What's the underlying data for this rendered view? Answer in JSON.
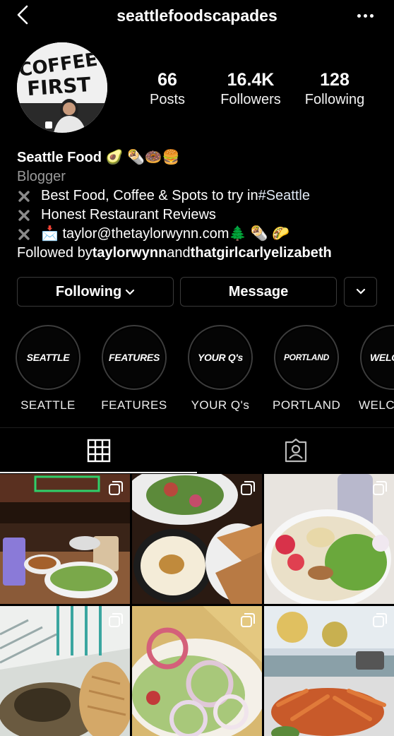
{
  "header": {
    "username": "seattlefoodscapades"
  },
  "avatar": {
    "sign_line1": "COFFEE",
    "sign_line2": "FIRST"
  },
  "stats": [
    {
      "value": "66",
      "label": "Posts"
    },
    {
      "value": "16.4K",
      "label": "Followers"
    },
    {
      "value": "128",
      "label": "Following"
    }
  ],
  "bio": {
    "name": "Seattle Food 🥑 🌯🍩🍔",
    "category": "Blogger",
    "line1_text": "Best Food, Coffee & Spots to try in ",
    "line1_hashtag": "#Seattle",
    "line2_text": "Honest Restaurant Reviews",
    "line3_text": "📩 taylor@thetaylorwynn.com🌲 🌯 🌮",
    "followed_prefix": "Followed by ",
    "followed_user1": "taylorwynn",
    "followed_and": " and ",
    "followed_user2": "thatgirlcarlyelizabeth"
  },
  "buttons": {
    "following": "Following",
    "message": "Message"
  },
  "highlights": [
    {
      "cover": "SEATTLE",
      "label": "SEATTLE"
    },
    {
      "cover": "FEATURES",
      "label": "FEATURES"
    },
    {
      "cover": "YOUR Q's",
      "label": "YOUR Q's"
    },
    {
      "cover": "PORTLAND",
      "label": "PORTLAND"
    },
    {
      "cover": "WELC",
      "label": "WELC"
    }
  ],
  "tabs": [
    {
      "name": "grid",
      "icon": "grid-icon",
      "active": true
    },
    {
      "name": "tagged",
      "icon": "tagged-icon",
      "active": false
    }
  ],
  "posts": [
    {
      "subject": "ramen-and-boba",
      "multi": true
    },
    {
      "subject": "salad-hummus-pita",
      "multi": true
    },
    {
      "subject": "poke-bowl",
      "multi": true
    },
    {
      "subject": "bread-and-clams",
      "multi": true
    },
    {
      "subject": "onion-salad",
      "multi": true
    },
    {
      "subject": "crab-by-the-sea",
      "multi": true
    }
  ],
  "colors": {
    "background": "#000000",
    "text": "#ffffff",
    "muted": "#9a9a9a",
    "border": "#3a3a3a"
  }
}
